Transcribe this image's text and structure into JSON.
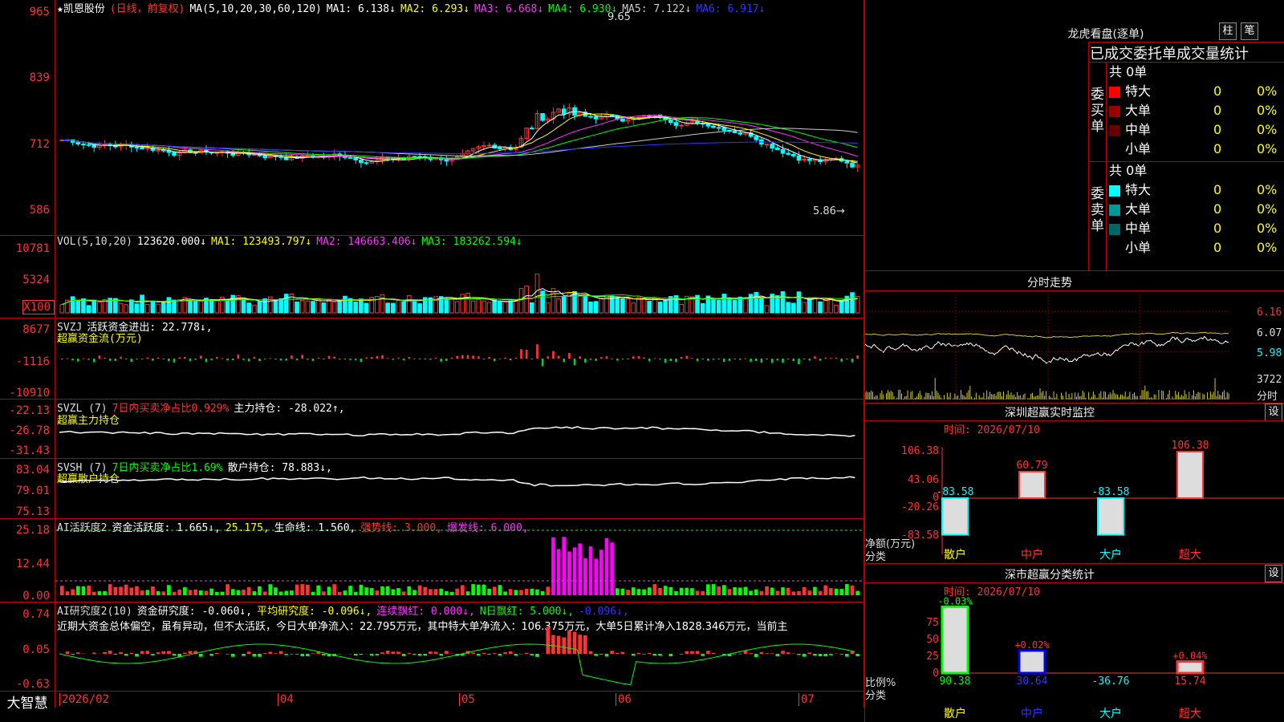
{
  "app": {
    "brand": "大智慧"
  },
  "main": {
    "stock_name": "★凯恩股份",
    "period_label": "(日线，前复权)",
    "ma_label": "MA(5,10,20,30,60,120)",
    "ma_values": [
      {
        "label": "MA1: 6.138↓",
        "color": "#ffffff"
      },
      {
        "label": "MA2: 6.293↓",
        "color": "#ffff00"
      },
      {
        "label": "MA3: 6.668↓",
        "color": "#ff33ff"
      },
      {
        "label": "MA4: 6.930↓",
        "color": "#00ff00"
      },
      {
        "label": "MA5: 7.122↓",
        "color": "#cccccc"
      },
      {
        "label": "MA6: 6.917↓",
        "color": "#3333ff"
      }
    ],
    "y_labels": [
      "965",
      "839",
      "712",
      "586"
    ],
    "high_label": "9.65",
    "low_label": "5.86→"
  },
  "vol": {
    "label": "VOL(5,10,20)",
    "values": [
      {
        "label": "123620.000↓",
        "color": "#ffffff"
      },
      {
        "label": "MA1: 123493.797↓",
        "color": "#ffff00"
      },
      {
        "label": "MA2: 146663.406↓",
        "color": "#ff33ff"
      },
      {
        "label": "MA3: 183262.594↓",
        "color": "#00ff00"
      }
    ],
    "y_labels": [
      "10781",
      "5324",
      "X100"
    ]
  },
  "svzj": {
    "label": "SVZJ",
    "value": "活跃资金进出: 22.778↓,",
    "sub": "超赢资金流(万元)",
    "y_labels": [
      "8677",
      "-1116",
      "-10910"
    ]
  },
  "svzl": {
    "label": "SVZL (7)",
    "pct": "7日内买卖净占比0.929%",
    "value": "主力持仓: -28.022↑,",
    "sub": "超赢主力持仓",
    "y_labels": [
      "-22.13",
      "-26.78",
      "-31.43"
    ]
  },
  "svsh": {
    "label": "SVSH (7)",
    "pct": "7日内买卖净占比1.69%",
    "value": "散户持仓: 78.883↓,",
    "sub": "超赢散户持仓",
    "y_labels": [
      "83.04",
      "79.01",
      "75.13"
    ]
  },
  "ai1": {
    "label": "AI活跃度2",
    "v1": "资金活跃度: 1.665↓,",
    "v2": "25.175,",
    "v3": "生命线: 1.560,",
    "v4": "强势线: 3.000,",
    "v5": "爆发线: 6.000,",
    "y_labels": [
      "25.18",
      "12.44",
      "0.00"
    ]
  },
  "ai2": {
    "label": "AI研究度2(10)",
    "v1": "资金研究度: -0.060↓,",
    "v2": "平均研究度: -0.096↓,",
    "v3": "连续飘红: 0.000↓,",
    "v4": "N日飘红: 5.000↓,",
    "v5": "-0.096↓,",
    "text": "近期大资金总体偏空，虽有异动，但不太活跃，今日大单净流入：22.795万元，其中特大单净流入：106.375万元，大单5日累计净入1828.346万元，当前主",
    "y_labels": [
      "0.74",
      "0.05",
      "-0.63"
    ]
  },
  "xaxis": {
    "labels": [
      "2026/02",
      "04",
      "05",
      "06",
      "07"
    ]
  },
  "lhb": {
    "title": "龙虎看盘(逐单)",
    "btn1": "柱",
    "btn2": "笔",
    "header": "已成交委托单成交量统计",
    "buy_side": "委买单",
    "sell_side": "委卖单",
    "buy_total": "共 0单",
    "sell_total": "共 0单",
    "buy_rows": [
      {
        "label": "特大",
        "count": "0",
        "pct": "0%",
        "color": "#ff0000"
      },
      {
        "label": "大单",
        "count": "0",
        "pct": "0%",
        "color": "#990000"
      },
      {
        "label": "中单",
        "count": "0",
        "pct": "0%",
        "color": "#660000"
      },
      {
        "label": "小单",
        "count": "0",
        "pct": "0%",
        "color": "#000000"
      }
    ],
    "sell_rows": [
      {
        "label": "特大",
        "count": "0",
        "pct": "0%",
        "color": "#00ffff"
      },
      {
        "label": "大单",
        "count": "0",
        "pct": "0%",
        "color": "#009999"
      },
      {
        "label": "中单",
        "count": "0",
        "pct": "0%",
        "color": "#006666"
      },
      {
        "label": "小单",
        "count": "0",
        "pct": "0%",
        "color": "#000000"
      }
    ]
  },
  "intraday": {
    "title": "分时走势",
    "y_labels": [
      "6.16",
      "6.07",
      "5.98"
    ],
    "vol_label": "3722",
    "vol_unit": "分时"
  },
  "sz_monitor": {
    "title": "深圳超赢实时监控",
    "btn": "设",
    "time": "时间: 2026/07/10",
    "y_labels": [
      "106.38",
      "43.06",
      "0",
      "-20.26",
      "-83.58"
    ],
    "y_caption": "净额(万元)",
    "x_caption": "分类",
    "categories": [
      "散户",
      "中户",
      "大户",
      "超大"
    ],
    "values": [
      -83.58,
      60.79,
      -83.58,
      106.38
    ],
    "value_labels": [
      "-83.58",
      "60.79",
      "-83.58",
      "106.38"
    ]
  },
  "sz_class": {
    "title": "深市超赢分类统计",
    "btn": "设",
    "time": "时间: 2026/07/10",
    "y_labels": [
      "75",
      "50",
      "25",
      "0"
    ],
    "y_caption": "比例%",
    "x_caption": "分类",
    "categories": [
      "散户",
      "中户",
      "大户",
      "超大"
    ],
    "top_labels": [
      "-0.03%",
      "+0.02%",
      "",
      "+0.04%"
    ],
    "values": [
      90.38,
      30.64,
      -36.76,
      15.74
    ],
    "value_labels": [
      "90.38",
      "30.64",
      "-36.76",
      "15.74"
    ]
  }
}
